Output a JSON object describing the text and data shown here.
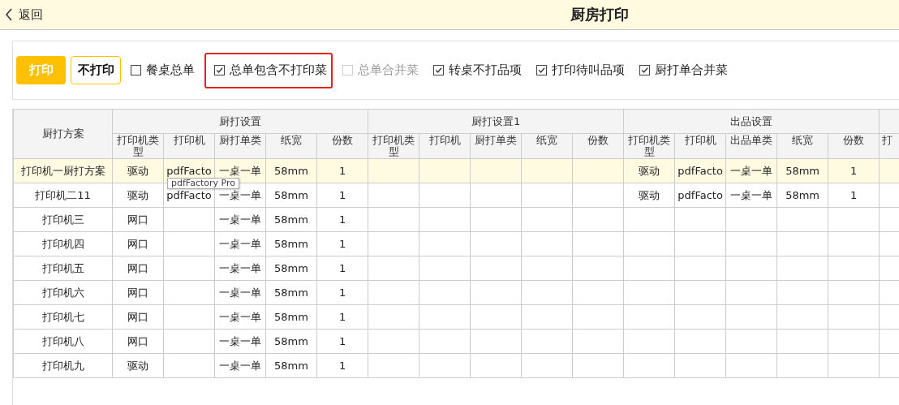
{
  "header": {
    "back": "返回",
    "title": "厨房打印"
  },
  "toolbar": {
    "buttons": [
      {
        "label": "打印",
        "kind": "primary"
      },
      {
        "label": "不打印",
        "kind": "secondary"
      }
    ],
    "checkboxes": [
      {
        "label": "餐桌总单",
        "checked": false,
        "disabled": false,
        "highlighted": false
      },
      {
        "label": "总单包含不打印菜",
        "checked": true,
        "disabled": false,
        "highlighted": true
      },
      {
        "label": "总单合并菜",
        "checked": false,
        "disabled": true,
        "highlighted": false
      },
      {
        "label": "转桌不打品项",
        "checked": true,
        "disabled": false,
        "highlighted": false
      },
      {
        "label": "打印待叫品项",
        "checked": true,
        "disabled": false,
        "highlighted": false
      },
      {
        "label": "厨打单合并菜",
        "checked": true,
        "disabled": false,
        "highlighted": false
      }
    ]
  },
  "table": {
    "first_column": "厨打方案",
    "groups": [
      {
        "title": "厨打设置",
        "columns": [
          "打印机类型",
          "打印机",
          "厨打单类",
          "纸宽",
          "份数"
        ]
      },
      {
        "title": "厨打设置1",
        "columns": [
          "打印机类型",
          "打印机",
          "厨打单类",
          "纸宽",
          "份数"
        ]
      },
      {
        "title": "出品设置",
        "columns": [
          "打印机类型",
          "打印机",
          "出品单类",
          "纸宽",
          "份数"
        ]
      },
      {
        "columns": [
          "打"
        ]
      }
    ],
    "rows": [
      {
        "selected": true,
        "hover_tooltip": "pdfFactory Pro",
        "cells": [
          "打印机一厨打方案",
          "驱动",
          "pdfFacto",
          "一桌一单",
          "58mm",
          "1",
          "",
          "",
          "",
          "",
          "",
          "驱动",
          "pdfFacto",
          "一桌一单",
          "58mm",
          "1",
          ""
        ]
      },
      {
        "selected": false,
        "cells": [
          "打印机二11",
          "驱动",
          "pdfFacto",
          "一桌一单",
          "58mm",
          "1",
          "",
          "",
          "",
          "",
          "",
          "驱动",
          "pdfFacto",
          "一桌一单",
          "58mm",
          "1",
          ""
        ]
      },
      {
        "selected": false,
        "cells": [
          "打印机三",
          "网口",
          "",
          "一桌一单",
          "58mm",
          "1",
          "",
          "",
          "",
          "",
          "",
          "",
          "",
          "",
          "",
          "",
          ""
        ]
      },
      {
        "selected": false,
        "cells": [
          "打印机四",
          "网口",
          "",
          "一桌一单",
          "58mm",
          "1",
          "",
          "",
          "",
          "",
          "",
          "",
          "",
          "",
          "",
          "",
          ""
        ]
      },
      {
        "selected": false,
        "cells": [
          "打印机五",
          "网口",
          "",
          "一桌一单",
          "58mm",
          "1",
          "",
          "",
          "",
          "",
          "",
          "",
          "",
          "",
          "",
          "",
          ""
        ]
      },
      {
        "selected": false,
        "cells": [
          "打印机六",
          "网口",
          "",
          "一桌一单",
          "58mm",
          "1",
          "",
          "",
          "",
          "",
          "",
          "",
          "",
          "",
          "",
          "",
          ""
        ]
      },
      {
        "selected": false,
        "cells": [
          "打印机七",
          "网口",
          "",
          "一桌一单",
          "58mm",
          "1",
          "",
          "",
          "",
          "",
          "",
          "",
          "",
          "",
          "",
          "",
          ""
        ]
      },
      {
        "selected": false,
        "cells": [
          "打印机八",
          "网口",
          "",
          "一桌一单",
          "58mm",
          "1",
          "",
          "",
          "",
          "",
          "",
          "",
          "",
          "",
          "",
          "",
          ""
        ]
      },
      {
        "selected": false,
        "cells": [
          "打印机九",
          "驱动",
          "",
          "一桌一单",
          "58mm",
          "1",
          "",
          "",
          "",
          "",
          "",
          "",
          "",
          "",
          "",
          "",
          ""
        ]
      }
    ]
  }
}
